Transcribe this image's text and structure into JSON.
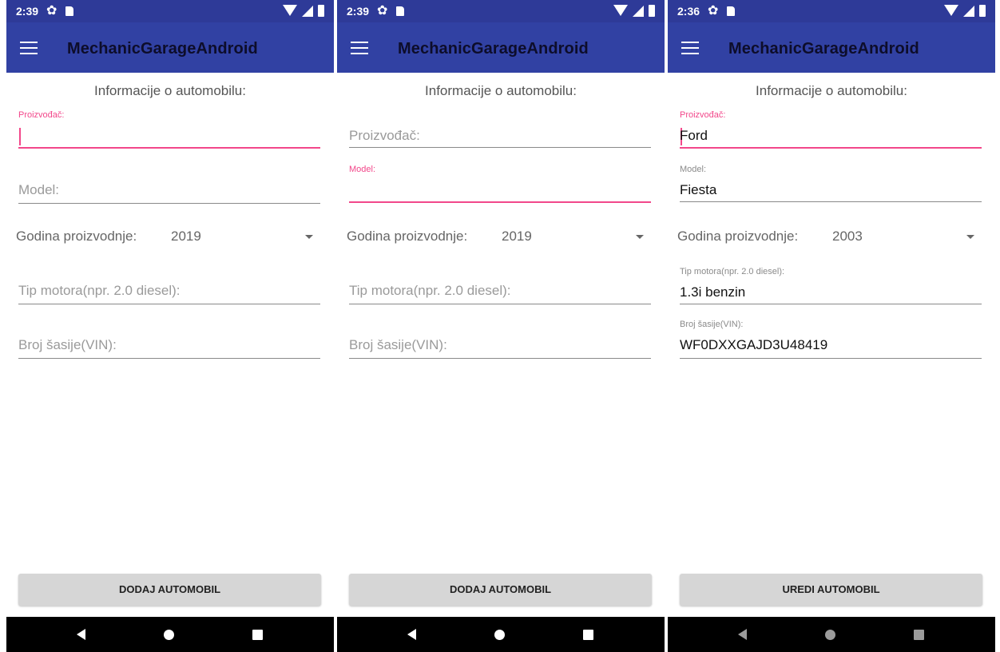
{
  "screens": [
    {
      "status_time": "2:39",
      "app_title": "MechanicGarageAndroid",
      "section_title": "Informacije o automobilu:",
      "manufacturer": {
        "label": "Proizvođač:",
        "value": ""
      },
      "model": {
        "hint": "Model:",
        "value": ""
      },
      "year": {
        "label": "Godina proizvodnje:",
        "value": "2019"
      },
      "engine": {
        "hint": "Tip motora(npr. 2.0 diesel):",
        "value": ""
      },
      "vin": {
        "hint": "Broj šasije(VIN):",
        "value": ""
      },
      "button_label": "DODAJ AUTOMOBIL"
    },
    {
      "status_time": "2:39",
      "app_title": "MechanicGarageAndroid",
      "section_title": "Informacije o automobilu:",
      "manufacturer": {
        "hint": "Proizvođač:",
        "value": ""
      },
      "model": {
        "label": "Model:",
        "value": ""
      },
      "year": {
        "label": "Godina proizvodnje:",
        "value": "2019"
      },
      "engine": {
        "hint": "Tip motora(npr. 2.0 diesel):",
        "value": ""
      },
      "vin": {
        "hint": "Broj šasije(VIN):",
        "value": ""
      },
      "button_label": "DODAJ AUTOMOBIL"
    },
    {
      "status_time": "2:36",
      "app_title": "MechanicGarageAndroid",
      "section_title": "Informacije o automobilu:",
      "manufacturer": {
        "label": "Proizvođač:",
        "value": "Ford"
      },
      "model": {
        "label": "Model:",
        "value": "Fiesta"
      },
      "year": {
        "label": "Godina proizvodnje:",
        "value": "2003"
      },
      "engine": {
        "label": "Tip motora(npr. 2.0 diesel):",
        "value": "1.3i benzin"
      },
      "vin": {
        "label": "Broj šasije(VIN):",
        "value": "WF0DXXGAJD3U48419"
      },
      "button_label": "UREDI AUTOMOBIL"
    }
  ],
  "colors": {
    "status_bar": "#2e3a98",
    "app_bar": "#3141a3",
    "accent": "#f2478a",
    "button": "#d6d6d6",
    "nav_bar": "#000000"
  },
  "icons": {
    "menu": "menu-icon",
    "gear": "gear-icon",
    "sd_card": "sd-card-icon",
    "wifi": "wifi-icon",
    "signal": "signal-icon",
    "battery": "battery-icon",
    "back": "back-icon",
    "home": "home-icon",
    "recents": "recents-icon"
  }
}
